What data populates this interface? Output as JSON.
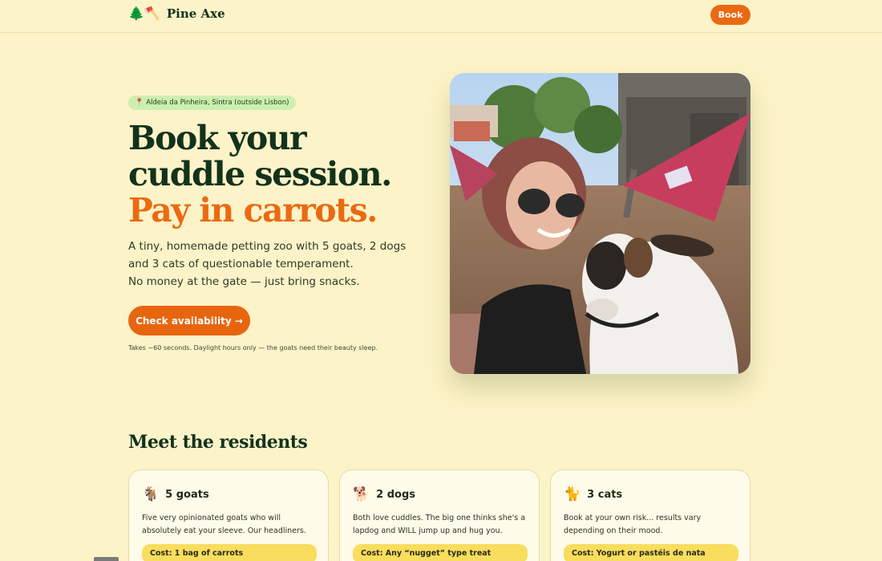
{
  "nav": {
    "brand_icons": "🌲🪓",
    "brand_name": "Pine Axe",
    "book_label": "Book"
  },
  "hero": {
    "location": "Aldeia da Pinheira, Sintra (outside Lisbon)",
    "headline_line1": "Book your",
    "headline_line2": "cuddle session.",
    "headline_accent": "Pay in carrots.",
    "lede_line1": "A tiny, homemade petting zoo with 5 goats, 2 dogs and 3 cats of questionable temperament.",
    "lede_line2": "No money at the gate — just bring snacks.",
    "cta_label": "Check availability →",
    "cta_note": "Takes ~60 seconds. Daylight hours only — the goats need their beauty sleep."
  },
  "residents": {
    "title": "Meet the residents",
    "cards": [
      {
        "emoji": "🐐",
        "title": "5 goats",
        "desc": "Five very opinionated goats who will absolutely eat your sleeve. Our headliners.",
        "cost": "Cost: 1 bag of carrots"
      },
      {
        "emoji": "🐕",
        "title": "2 dogs",
        "desc": "Both love cuddles. The big one thinks she's a lapdog and WILL jump up and hug you.",
        "cost": "Cost: Any “nugget” type treat"
      },
      {
        "emoji": "🐈",
        "title": "3 cats",
        "desc": "Book at your own risk... results vary depending on their mood.",
        "cost": "Cost: Yogurt or pastéis de nata"
      }
    ]
  },
  "colors": {
    "background": "#fdf3c8",
    "accent": "#ea6a12",
    "forest": "#13321c",
    "badge": "#ccefb1",
    "cost_pill": "#f8dd5e"
  }
}
